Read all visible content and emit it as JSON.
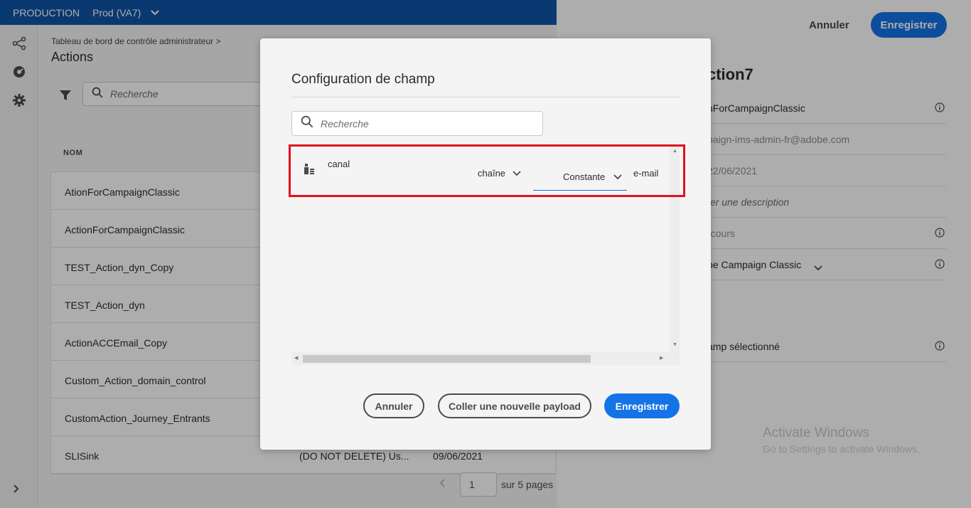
{
  "topbar": {
    "org": "PRODUCTION",
    "sandbox": "Prod (VA7)"
  },
  "main": {
    "breadcrumb": "Tableau de bord de contrôle administrateur >",
    "title": "Actions",
    "search_placeholder": "Recherche",
    "column_name": "NOM",
    "rows": [
      {
        "name": "AtionForCampaignClassic",
        "desc": "",
        "date": ""
      },
      {
        "name": "ActionForCampaignClassic",
        "desc": "",
        "date": ""
      },
      {
        "name": "TEST_Action_dyn_Copy",
        "desc": "",
        "date": ""
      },
      {
        "name": "TEST_Action_dyn",
        "desc": "",
        "date": ""
      },
      {
        "name": "ActionACCEmail_Copy",
        "desc": "",
        "date": ""
      },
      {
        "name": "Custom_Action_domain_control",
        "desc": "",
        "date": ""
      },
      {
        "name": "CustomAction_Journey_Entrants",
        "desc": "",
        "date": ""
      },
      {
        "name": "SLISink",
        "desc": "(DO NOT DELETE) Us...",
        "date": "09/06/2021"
      }
    ],
    "pager": {
      "current": "1",
      "total_label": "sur 5 pages"
    }
  },
  "right": {
    "cancel_label": "Annuler",
    "save_label": "Enregistrer",
    "title": "ction7",
    "fields": [
      "nForCampaignClassic",
      "paign-ims-admin-fr@adobe.com",
      "22/06/2021",
      "ter une description",
      "rcours",
      "be Campaign Classic",
      "amp sélectionné"
    ],
    "watermark_title": "Activate Windows",
    "watermark_sub": "Go to Settings to activate Windows."
  },
  "modal": {
    "title": "Configuration de champ",
    "search_placeholder": "Recherche",
    "field": {
      "name": "canal",
      "type": "chaîne",
      "mode": "Constante",
      "value": "e-mail"
    },
    "cancel_label": "Annuler",
    "paste_label": "Coller une nouvelle payload",
    "save_label": "Enregistrer"
  },
  "colors": {
    "accent": "#1473e6",
    "topbar": "#0f55a8",
    "highlight": "#e0111d"
  }
}
